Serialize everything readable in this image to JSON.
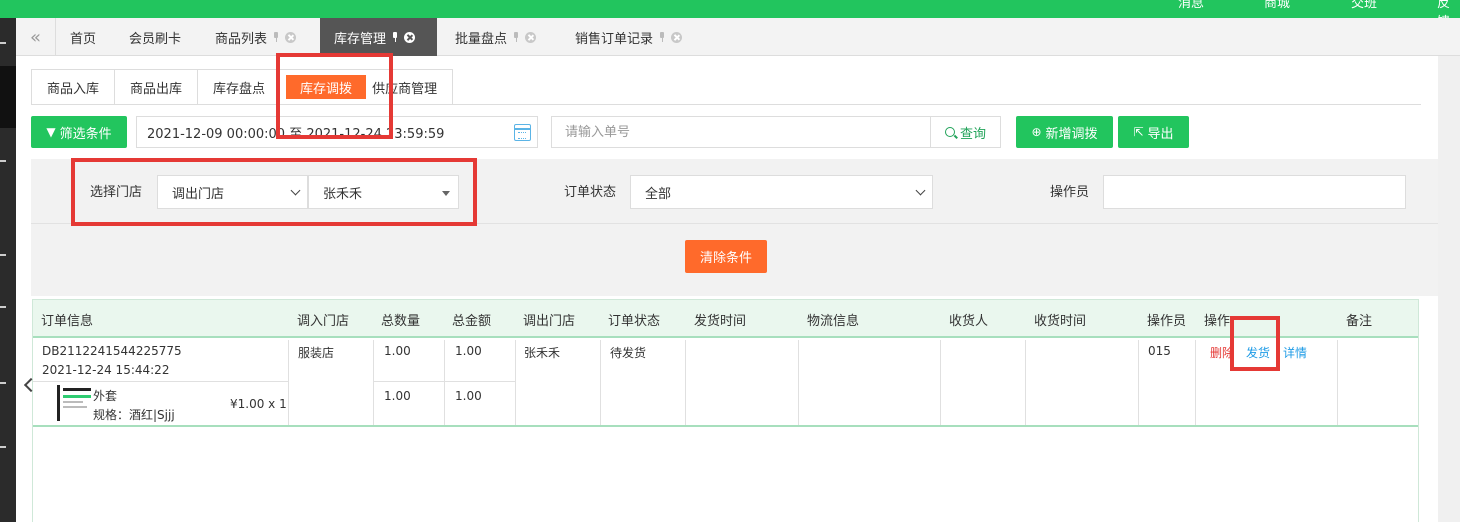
{
  "topbar": {
    "items": [
      "消息",
      "商城",
      "交班",
      "反馈"
    ]
  },
  "tabstrip": {
    "collapse_icon": "double-chevron-left-icon",
    "tabs": [
      {
        "label": "首页",
        "pinnable": false,
        "active": false
      },
      {
        "label": "会员刷卡",
        "pinnable": false,
        "active": false
      },
      {
        "label": "商品列表",
        "pinnable": true,
        "active": false
      },
      {
        "label": "库存管理",
        "pinnable": true,
        "active": true
      },
      {
        "label": "批量盘点",
        "pinnable": true,
        "active": false
      },
      {
        "label": "销售订单记录",
        "pinnable": true,
        "active": false
      }
    ]
  },
  "subtabs": [
    "商品入库",
    "商品出库",
    "库存盘点",
    "库存调拨",
    "供应商管理"
  ],
  "subtabs_active": "库存调拨",
  "toolbar": {
    "filter_label": "筛选条件",
    "date_range": "2021-12-09 00:00:00 至 2021-12-24 23:59:59",
    "search_placeholder": "请输入单号",
    "search_label": "查询",
    "add_label": "新增调拨",
    "export_label": "导出"
  },
  "filters": {
    "store_label": "选择门店",
    "store_type_value": "调出门店",
    "store_person_value": "张禾禾",
    "status_label": "订单状态",
    "status_value": "全部",
    "operator_label": "操作员",
    "operator_value": "",
    "clear_label": "清除条件"
  },
  "table": {
    "columns": [
      "订单信息",
      "调入门店",
      "总数量",
      "总金额",
      "调出门店",
      "订单状态",
      "发货时间",
      "物流信息",
      "收货人",
      "收货时间",
      "操作员",
      "操作",
      "备注"
    ],
    "rows": [
      {
        "order_no": "DB2112241544225775",
        "order_time": "2021-12-24 15:44:22",
        "in_store": "服装店",
        "total_qty": "1.00",
        "total_amount": "1.00",
        "out_store": "张禾禾",
        "status": "待发货",
        "ship_time": "",
        "logistics": "",
        "receiver": "",
        "receive_time": "",
        "operator": "015",
        "actions": [
          "删除",
          "发货",
          "详情"
        ],
        "note": "",
        "item": {
          "name": "外套",
          "spec": "规格：酒红|Sjjj",
          "price_qty": "¥1.00 x 1",
          "qty": "1.00",
          "amount": "1.00"
        }
      }
    ]
  },
  "colors": {
    "brand_green": "#22c55e",
    "accent_orange": "#ff6a2b",
    "annotation_red": "#e53935",
    "link_blue": "#1e9be6"
  }
}
